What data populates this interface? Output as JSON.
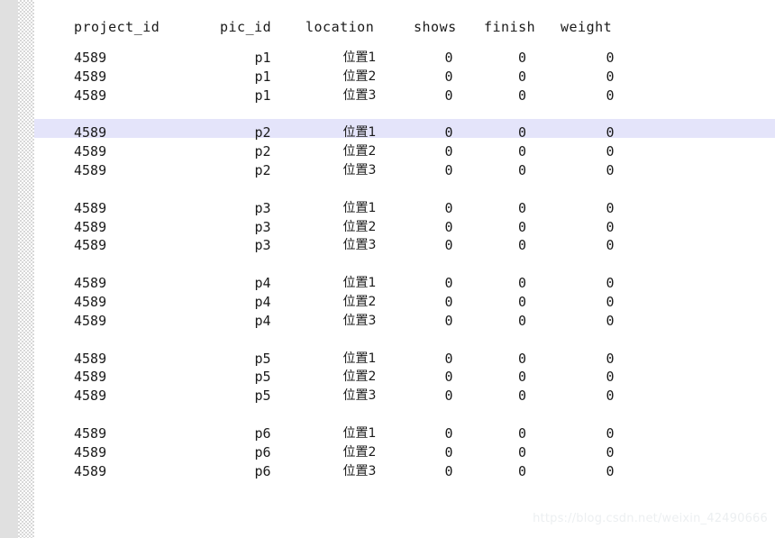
{
  "table": {
    "columns": [
      {
        "key": "project_id",
        "label": "project_id",
        "align": "left"
      },
      {
        "key": "pic_id",
        "label": "pic_id",
        "align": "center"
      },
      {
        "key": "location",
        "label": "location",
        "align": "center"
      },
      {
        "key": "shows",
        "label": "shows",
        "align": "center"
      },
      {
        "key": "finish",
        "label": "finish",
        "align": "center"
      },
      {
        "key": "weight",
        "label": "weight",
        "align": "center"
      }
    ],
    "groups": [
      {
        "pic_id": "p1",
        "rows": [
          {
            "project_id": "4589",
            "pic_id": "p1",
            "location": "位置1",
            "shows": "0",
            "finish": "0",
            "weight": "0"
          },
          {
            "project_id": "4589",
            "pic_id": "p1",
            "location": "位置2",
            "shows": "0",
            "finish": "0",
            "weight": "0"
          },
          {
            "project_id": "4589",
            "pic_id": "p1",
            "location": "位置3",
            "shows": "0",
            "finish": "0",
            "weight": "0"
          }
        ],
        "separator_selected": true
      },
      {
        "pic_id": "p2",
        "rows": [
          {
            "project_id": "4589",
            "pic_id": "p2",
            "location": "位置1",
            "shows": "0",
            "finish": "0",
            "weight": "0"
          },
          {
            "project_id": "4589",
            "pic_id": "p2",
            "location": "位置2",
            "shows": "0",
            "finish": "0",
            "weight": "0"
          },
          {
            "project_id": "4589",
            "pic_id": "p2",
            "location": "位置3",
            "shows": "0",
            "finish": "0",
            "weight": "0"
          }
        ],
        "separator_selected": false
      },
      {
        "pic_id": "p3",
        "rows": [
          {
            "project_id": "4589",
            "pic_id": "p3",
            "location": "位置1",
            "shows": "0",
            "finish": "0",
            "weight": "0"
          },
          {
            "project_id": "4589",
            "pic_id": "p3",
            "location": "位置2",
            "shows": "0",
            "finish": "0",
            "weight": "0"
          },
          {
            "project_id": "4589",
            "pic_id": "p3",
            "location": "位置3",
            "shows": "0",
            "finish": "0",
            "weight": "0"
          }
        ],
        "separator_selected": false
      },
      {
        "pic_id": "p4",
        "rows": [
          {
            "project_id": "4589",
            "pic_id": "p4",
            "location": "位置1",
            "shows": "0",
            "finish": "0",
            "weight": "0"
          },
          {
            "project_id": "4589",
            "pic_id": "p4",
            "location": "位置2",
            "shows": "0",
            "finish": "0",
            "weight": "0"
          },
          {
            "project_id": "4589",
            "pic_id": "p4",
            "location": "位置3",
            "shows": "0",
            "finish": "0",
            "weight": "0"
          }
        ],
        "separator_selected": false
      },
      {
        "pic_id": "p5",
        "rows": [
          {
            "project_id": "4589",
            "pic_id": "p5",
            "location": "位置1",
            "shows": "0",
            "finish": "0",
            "weight": "0"
          },
          {
            "project_id": "4589",
            "pic_id": "p5",
            "location": "位置2",
            "shows": "0",
            "finish": "0",
            "weight": "0"
          },
          {
            "project_id": "4589",
            "pic_id": "p5",
            "location": "位置3",
            "shows": "0",
            "finish": "0",
            "weight": "0"
          }
        ],
        "separator_selected": false
      },
      {
        "pic_id": "p6",
        "rows": [
          {
            "project_id": "4589",
            "pic_id": "p6",
            "location": "位置1",
            "shows": "0",
            "finish": "0",
            "weight": "0"
          },
          {
            "project_id": "4589",
            "pic_id": "p6",
            "location": "位置2",
            "shows": "0",
            "finish": "0",
            "weight": "0"
          },
          {
            "project_id": "4589",
            "pic_id": "p6",
            "location": "位置3",
            "shows": "0",
            "finish": "0",
            "weight": "0"
          }
        ],
        "separator_selected": false
      }
    ]
  },
  "watermark": {
    "text": "https://blog.csdn.net/weixin_42490666"
  },
  "colors": {
    "number": "#ef9545",
    "text": "#1a1a1a",
    "highlight": "#e4e4fa",
    "left_margin": "#e0e0e0",
    "background": "#ffffff",
    "watermark": "#eceff1"
  }
}
